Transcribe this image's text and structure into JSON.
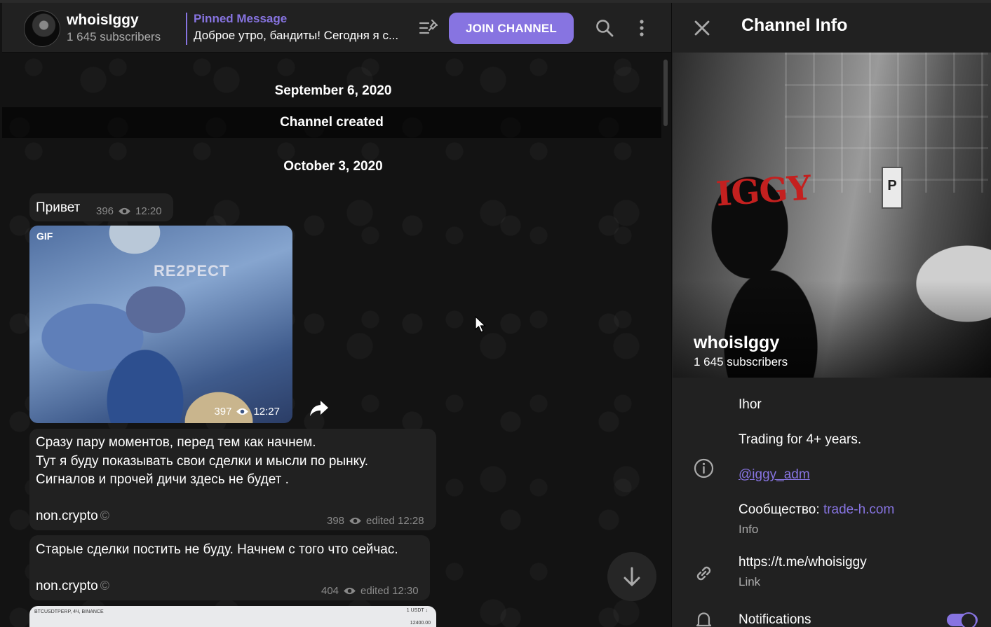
{
  "channel": {
    "name": "whoisIggy",
    "subscribers": "1 645 subscribers"
  },
  "pinned": {
    "title": "Pinned Message",
    "text": "Доброе утро, бандиты! Сегодня я с..."
  },
  "header": {
    "join_label": "JOIN CHANNEL"
  },
  "messages": {
    "date1": "September 6, 2020",
    "service": "Channel created",
    "date2": "October 3, 2020",
    "m1": {
      "text": "Привет",
      "views": "396",
      "time": "12:20"
    },
    "gif": {
      "badge": "GIF",
      "views": "397",
      "time": "12:27"
    },
    "m2": {
      "line1": "Сразу пару моментов, перед тем как начнем.",
      "line2": "Тут я буду показывать свои сделки и мысли по рынку.",
      "line3": "Сигналов и прочей дичи здесь не будет .",
      "signature": "non.crypto",
      "views": "398",
      "time": "edited 12:28"
    },
    "m3": {
      "text": "Старые сделки постить не буду. Начнем с того что сейчас.",
      "signature": "non.crypto",
      "views": "404",
      "time": "edited 12:30"
    },
    "chart_preview": {
      "symbol": "BTCUSDTPERP, 4Ч, BINANCE",
      "tag": "1 USDT ↓",
      "price": "12400.00"
    }
  },
  "panel": {
    "title": "Channel Info",
    "cover_name": "whoisIggy",
    "cover_subs": "1 645 subscribers",
    "about_line1": "Ihor",
    "about_line2": "Trading for 4+ years.",
    "about_mention": "@iggy_adm",
    "about_community_prefix": "Сообщество: ",
    "about_community_link": "trade-h.com",
    "about_caption": "Info",
    "link_value": "https://t.me/whoisiggy",
    "link_caption": "Link",
    "notifications_label": "Notifications",
    "notifications_on": true
  },
  "colors": {
    "accent": "#8774e1",
    "bubble": "#212121",
    "panel": "#212121",
    "muted": "#aaaaaa"
  }
}
